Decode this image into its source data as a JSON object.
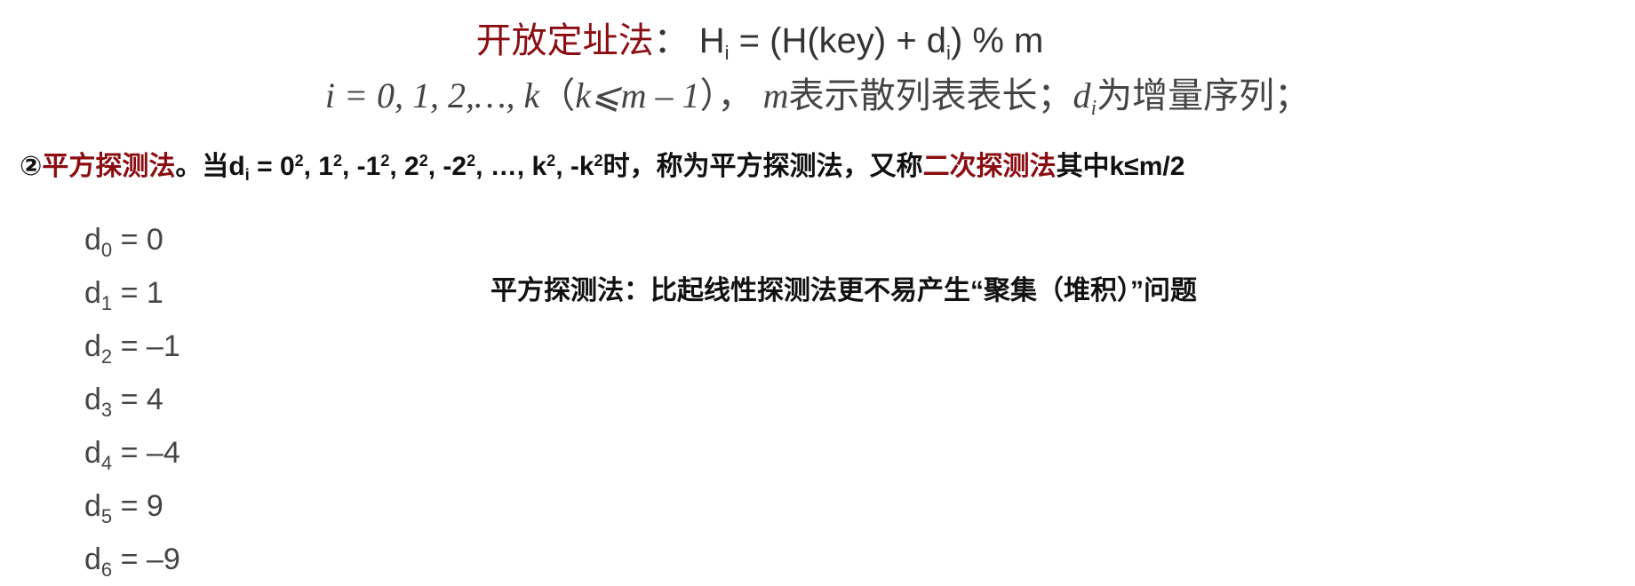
{
  "formula": {
    "term": "开放定址法",
    "colon": "：",
    "expr_start": "H",
    "expr_sub1": "i",
    "expr_mid": " = (H(key) + d",
    "expr_sub2": "i",
    "expr_end": ") % m"
  },
  "index_line": {
    "range": "i = 0, 1, 2,…, k",
    "cond_open": "（",
    "cond": "k⩽m – 1",
    "cond_close": "），",
    "m_var": "m",
    "m_desc": "表示散列表表长；",
    "d_var": "d",
    "d_sub": "i",
    "d_desc": "为增量序列；"
  },
  "method": {
    "circle": "②",
    "name": "平方探测法",
    "dot": "。当d",
    "d_sub": "i",
    "seq_parts": [
      " = 0",
      "2",
      ", 1",
      "2",
      ", -1",
      "2",
      ", 2",
      "2",
      ", -2",
      "2",
      ", …, k",
      "2",
      ", -k",
      "2"
    ],
    "after": "时，称为平方探测法，又称",
    "alt_name": "二次探测法",
    "tail": "其中k≤m/2"
  },
  "sequence": [
    {
      "sub": "0",
      "rest": " = 0"
    },
    {
      "sub": "1",
      "rest": " = 1"
    },
    {
      "sub": "2",
      "rest": " = –1"
    },
    {
      "sub": "3",
      "rest": " = 4"
    },
    {
      "sub": "4",
      "rest": " = –4"
    },
    {
      "sub": "5",
      "rest": " = 9"
    },
    {
      "sub": "6",
      "rest": " = –9"
    }
  ],
  "note": "平方探测法：比起线性探测法更不易产生“聚集（堆积）”问题"
}
